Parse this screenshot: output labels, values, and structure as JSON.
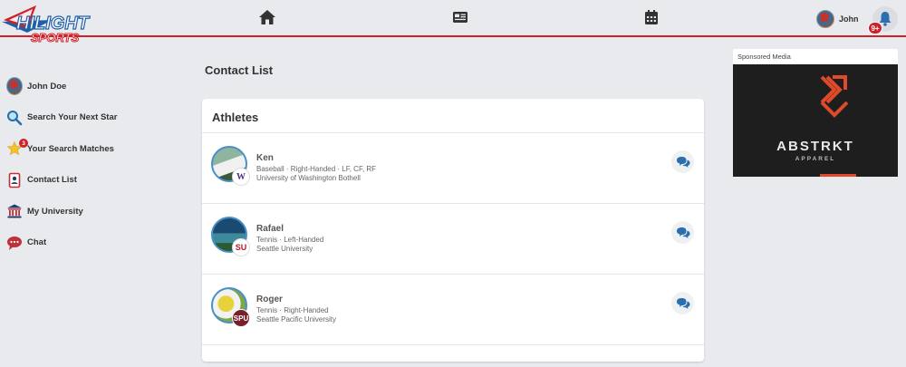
{
  "header": {
    "logo_top": "HILIGHT",
    "logo_bottom": "SPORTS",
    "nav": [
      {
        "icon": "home-icon"
      },
      {
        "icon": "newspaper-icon"
      },
      {
        "icon": "calendar-icon"
      }
    ],
    "user_name": "John",
    "notification_count": "9+"
  },
  "sidebar": {
    "items": [
      {
        "label": "John Doe",
        "icon": "avatar"
      },
      {
        "label": "Search Your Next Star",
        "icon": "search-icon"
      },
      {
        "label": "Your Search Matches",
        "icon": "star-icon",
        "badge": "3"
      },
      {
        "label": "Contact List",
        "icon": "contact-book-icon"
      },
      {
        "label": "My University",
        "icon": "university-icon"
      },
      {
        "label": "Chat",
        "icon": "chat-bubble-icon"
      }
    ]
  },
  "main": {
    "page_title": "Contact List",
    "card_title": "Athletes",
    "athletes": [
      {
        "name": "Ken",
        "details": "Baseball · Right-Handed · LF, CF, RF",
        "school": "University of Washington Bothell",
        "school_logo": "W"
      },
      {
        "name": "Rafael",
        "details": "Tennis · Left-Handed",
        "school": "Seattle University",
        "school_logo": "SU"
      },
      {
        "name": "Roger",
        "details": "Tennis · Right-Handed",
        "school": "Seattle Pacific University",
        "school_logo": "SPU"
      }
    ]
  },
  "sponsor": {
    "label": "Sponsored Media",
    "brand": "ABSTRKT",
    "brand_sub": "APPAREL",
    "colors": {
      "accent": "#e04a2a",
      "background": "#1e1e1e"
    }
  },
  "colors": {
    "brand_red": "#d0202a",
    "brand_blue": "#1f5fa8",
    "link_blue": "#2a6fb0"
  }
}
